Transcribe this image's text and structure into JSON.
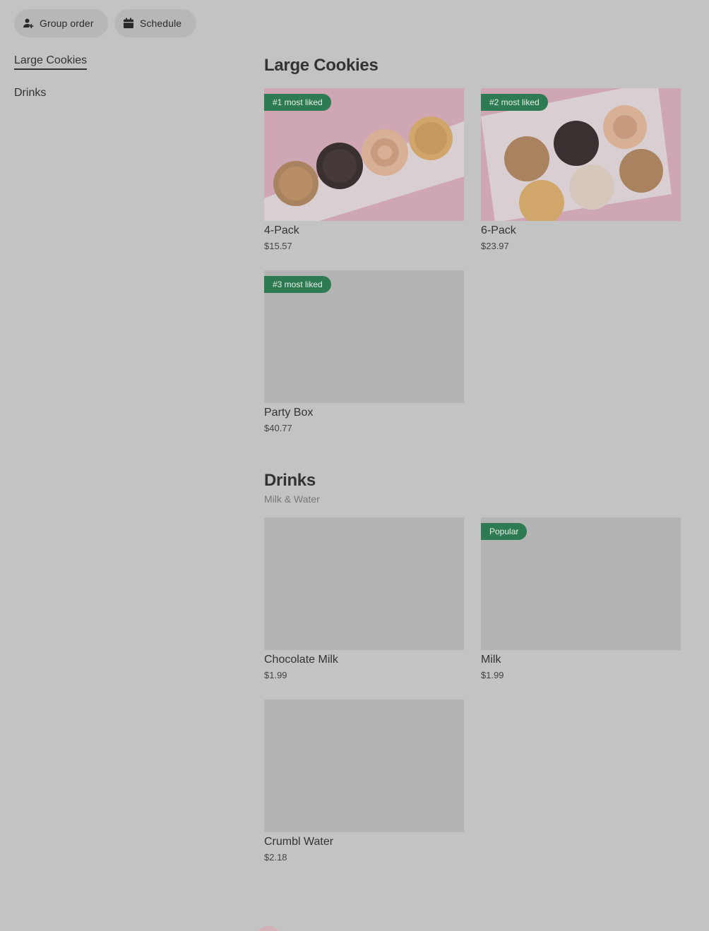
{
  "toolbar": {
    "group_order": "Group order",
    "schedule": "Schedule",
    "group_icon": "person-add-icon",
    "schedule_icon": "calendar-icon"
  },
  "sidebar": {
    "items": [
      {
        "label": "Large Cookies",
        "active": true
      },
      {
        "label": "Drinks",
        "active": false
      }
    ]
  },
  "sections": [
    {
      "title": "Large Cookies",
      "subtitle": "",
      "items": [
        {
          "name": "4-Pack",
          "price": "$15.57",
          "badge": "#1 most liked"
        },
        {
          "name": "6-Pack",
          "price": "$23.97",
          "badge": "#2 most liked"
        },
        {
          "name": "Party Box",
          "price": "$40.77",
          "badge": "#3 most liked"
        }
      ]
    },
    {
      "title": "Drinks",
      "subtitle": "Milk & Water",
      "items": [
        {
          "name": "Chocolate Milk",
          "price": "$1.99",
          "badge": ""
        },
        {
          "name": "Milk",
          "price": "$1.99",
          "badge": "Popular"
        },
        {
          "name": "Crumbl Water",
          "price": "$2.18",
          "badge": ""
        }
      ]
    }
  ],
  "colors": {
    "overlay_bg": "#c3c3c3",
    "badge_green": "#2e7a52",
    "placeholder": "#b4b4b4",
    "cookie_box_pink": "#cfa6b3"
  }
}
